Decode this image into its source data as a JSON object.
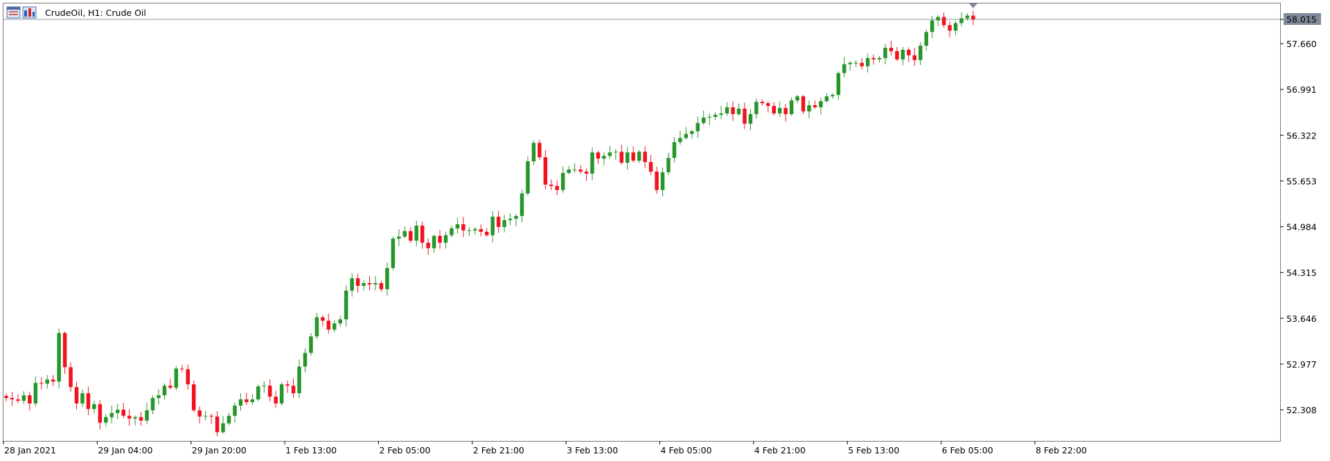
{
  "header": {
    "symbol_label": "CrudeOil, H1:  Crude Oil"
  },
  "colors": {
    "bull": "#26962b",
    "bear": "#f2121f",
    "price_line": "#8a99a6",
    "price_tag_bg": "#7f8b9a",
    "price_tag_text": "#ffffff",
    "frame": "#7a7a7a"
  },
  "current_price_tag": "58.015",
  "chart_data": {
    "type": "candlestick",
    "symbol": "CrudeOil",
    "timeframe": "H1",
    "description": "Crude Oil",
    "ylim": [
      51.78,
      58.2
    ],
    "grid": false,
    "y_ticks": [
      "58.015",
      "57.660",
      "56.991",
      "56.322",
      "55.653",
      "54.984",
      "54.315",
      "53.646",
      "52.977",
      "52.308"
    ],
    "x_ticks": [
      "28 Jan 2021",
      "29 Jan 04:00",
      "29 Jan 20:00",
      "1 Feb 13:00",
      "2 Feb 05:00",
      "2 Feb 21:00",
      "3 Feb 13:00",
      "4 Feb 05:00",
      "4 Feb 21:00",
      "5 Feb 13:00",
      "6 Feb 05:00",
      "8 Feb 22:00"
    ],
    "x_tick_bar_index": [
      0,
      16,
      32,
      48,
      64,
      80,
      96,
      112,
      128,
      144,
      160,
      176
    ],
    "last_price": 58.015,
    "closes": [
      52.48,
      52.46,
      52.44,
      52.52,
      52.4,
      52.7,
      52.69,
      52.75,
      52.72,
      53.43,
      52.93,
      52.64,
      52.4,
      52.55,
      52.32,
      52.39,
      52.12,
      52.2,
      52.26,
      52.31,
      52.22,
      52.18,
      52.2,
      52.15,
      52.3,
      52.48,
      52.52,
      52.66,
      52.63,
      52.91,
      52.9,
      52.68,
      52.3,
      52.21,
      52.22,
      52.21,
      51.98,
      52.11,
      52.22,
      52.37,
      52.46,
      52.42,
      52.46,
      52.65,
      52.66,
      52.5,
      52.4,
      52.68,
      52.66,
      52.55,
      52.94,
      53.14,
      53.38,
      53.66,
      53.61,
      53.48,
      53.57,
      53.63,
      54.05,
      54.23,
      54.12,
      54.16,
      54.14,
      54.16,
      54.07,
      54.38,
      54.81,
      54.84,
      54.92,
      54.78,
      55.0,
      54.75,
      54.67,
      54.85,
      54.75,
      54.86,
      54.96,
      55.02,
      54.93,
      54.93,
      54.95,
      54.91,
      54.86,
      55.13,
      54.98,
      55.08,
      55.1,
      55.14,
      55.47,
      55.94,
      56.21,
      56.0,
      55.6,
      55.58,
      55.52,
      55.77,
      55.82,
      55.82,
      55.79,
      55.76,
      56.07,
      55.98,
      56.02,
      56.07,
      56.08,
      55.92,
      56.07,
      55.95,
      56.08,
      55.93,
      55.79,
      55.52,
      55.78,
      55.99,
      56.22,
      56.28,
      56.34,
      56.38,
      56.5,
      56.58,
      56.59,
      56.62,
      56.64,
      56.73,
      56.63,
      56.71,
      56.49,
      56.63,
      56.81,
      56.79,
      56.75,
      56.64,
      56.72,
      56.63,
      56.83,
      56.89,
      56.67,
      56.76,
      56.73,
      56.82,
      56.89,
      56.91,
      57.23,
      57.36,
      57.38,
      57.38,
      57.33,
      57.45,
      57.43,
      57.45,
      57.6,
      57.55,
      57.43,
      57.57,
      57.49,
      57.42,
      57.63,
      57.83,
      58.0,
      58.05,
      57.93,
      57.85,
      57.96,
      58.03,
      58.07,
      58.015
    ]
  }
}
